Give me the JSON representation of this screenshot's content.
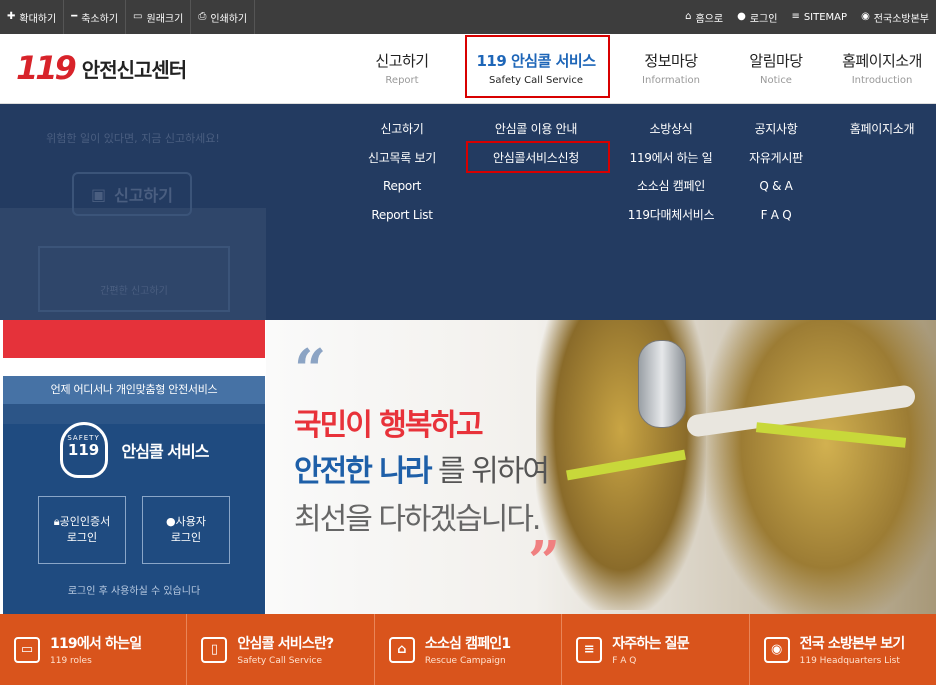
{
  "utility": {
    "left": [
      {
        "icon": "plus-icon",
        "label": "확대하기"
      },
      {
        "icon": "minus-icon",
        "label": "축소하기"
      },
      {
        "icon": "monitor-icon",
        "label": "원래크기"
      },
      {
        "icon": "print-icon",
        "label": "인쇄하기"
      }
    ],
    "right": [
      {
        "icon": "home-icon",
        "label": "홈으로"
      },
      {
        "icon": "user-icon",
        "label": "로그인"
      },
      {
        "icon": "menu-icon",
        "label": "SITEMAP"
      },
      {
        "icon": "location-icon",
        "label": "전국소방본부"
      }
    ]
  },
  "logo": {
    "mark": "119",
    "text": "안전신고센터"
  },
  "gnb": [
    {
      "k": "신고하기",
      "e": "Report"
    },
    {
      "k": "119 안심콜 서비스",
      "e": "Safety Call Service",
      "active": true
    },
    {
      "k": "정보마당",
      "e": "Information"
    },
    {
      "k": "알림마당",
      "e": "Notice"
    },
    {
      "k": "홈페이지소개",
      "e": "Introduction"
    }
  ],
  "mega": [
    [
      "신고하기",
      "신고목록 보기",
      "Report",
      "Report List"
    ],
    [
      "안심콜 이용 안내",
      "안심콜서비스신청"
    ],
    [
      "소방상식",
      "119에서 하는 일",
      "소소심 캠페인",
      "119다매체서비스"
    ],
    [
      "공지사항",
      "자유게시판",
      "Q & A",
      "F A Q"
    ],
    [
      "홈페이지소개"
    ]
  ],
  "ghost": {
    "text": "위험한 일이 있다면, 지금 신고하세요!",
    "report": "신고하기",
    "box": "간편한 신고하기"
  },
  "hero": {
    "line1": "국민이 행복하고",
    "line2_bold": "안전한 나라",
    "line2_rest": "를 위하여",
    "line3": "최선을 다하겠습니다."
  },
  "left_panel": {
    "heading": "언제 어디서나 개인맞춤형 안전서비스",
    "badge_top": "SAFETY",
    "badge_num": "119",
    "service": "안심콜 서비스",
    "btn1_l1": "공인인증서",
    "btn1_l2": "로그인",
    "btn2_l1": "사용자",
    "btn2_l2": "로그인",
    "note": "로그인 후 사용하실 수 있습니다"
  },
  "bottom": [
    {
      "icon": "monitor-icon",
      "k": "119에서 하는일",
      "e": "119 roles"
    },
    {
      "icon": "phone-icon",
      "k": "안심콜 서비스란?",
      "e": "Safety Call Service"
    },
    {
      "icon": "house-icon",
      "k": "소소심 캠페인1",
      "e": "Rescue Campaign"
    },
    {
      "icon": "chat-icon",
      "k": "자주하는 질문",
      "e": "F A Q"
    },
    {
      "icon": "pin-icon",
      "k": "전국 소방본부 보기",
      "e": "119 Headquarters List"
    }
  ]
}
